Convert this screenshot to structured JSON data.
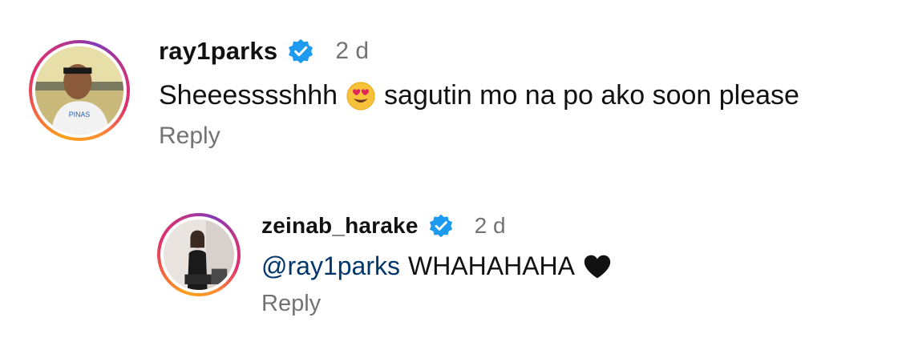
{
  "comments": [
    {
      "username": "ray1parks",
      "verified_icon": "verified-badge-icon",
      "time": "2 d",
      "text_before": "Sheeesssshhh",
      "emoji": "heart-eyes-emoji",
      "text_after": "sagutin mo na po ako soon please",
      "reply_label": "Reply"
    },
    {
      "username": "zeinab_harake",
      "verified_icon": "verified-badge-icon",
      "time": "2 d",
      "mention": "@ray1parks",
      "text_after": "WHAHAHAHA",
      "emoji": "black-heart-emoji",
      "reply_label": "Reply"
    }
  ],
  "colors": {
    "verified": "#1d9bf0",
    "mention": "#00376b",
    "secondary_text": "#737373"
  }
}
